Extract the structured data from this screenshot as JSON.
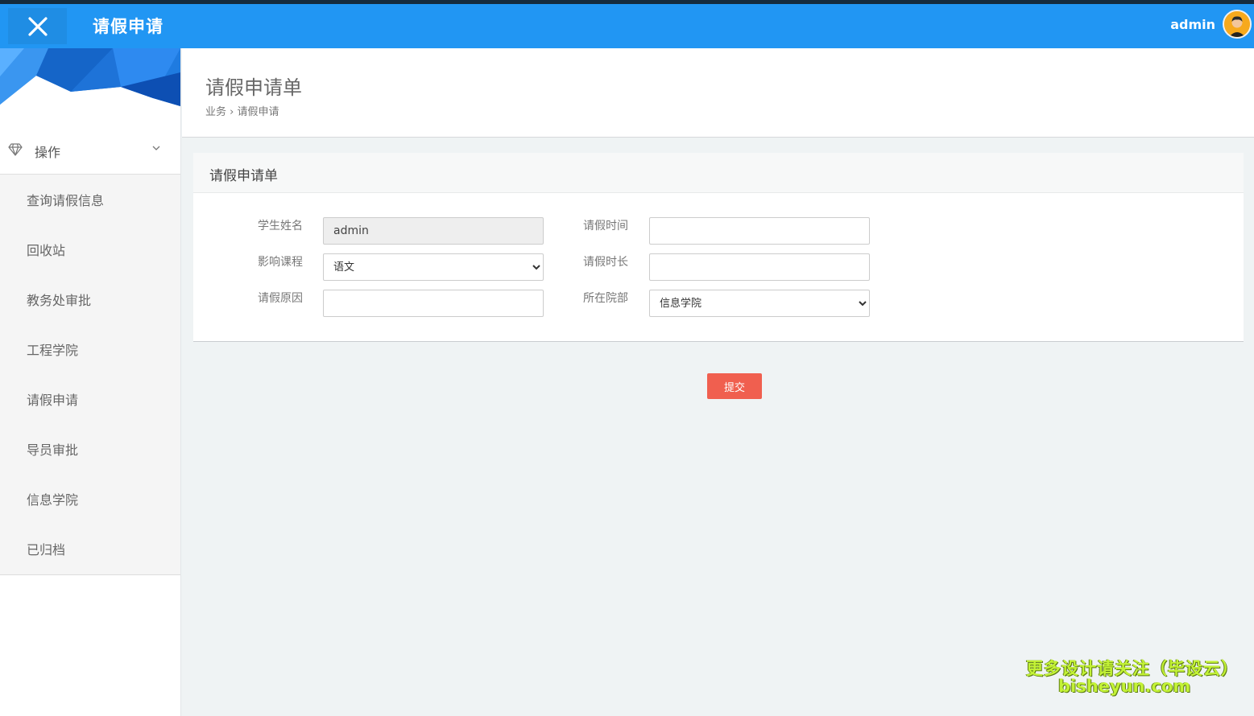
{
  "header": {
    "close_icon": "close-icon",
    "title": "请假申请",
    "user_name": "admin",
    "brand_color": "#2196f3"
  },
  "sidebar": {
    "group": {
      "icon": "diamond-icon",
      "label": "操作",
      "chevron": "chevron-down-icon"
    },
    "items": [
      {
        "label": "查询请假信息"
      },
      {
        "label": "回收站"
      },
      {
        "label": "教务处审批"
      },
      {
        "label": "工程学院"
      },
      {
        "label": "请假申请"
      },
      {
        "label": "导员审批"
      },
      {
        "label": "信息学院"
      },
      {
        "label": "已归档"
      }
    ]
  },
  "page": {
    "title": "请假申请单",
    "breadcrumb": {
      "parent": "业务",
      "separator": "›",
      "current": "请假申请"
    }
  },
  "form": {
    "panel_title": "请假申请单",
    "student_name": {
      "label": "学生姓名",
      "value": "admin"
    },
    "leave_time": {
      "label": "请假时间",
      "value": ""
    },
    "course": {
      "label": "影响课程",
      "selected": "语文"
    },
    "duration": {
      "label": "请假时长",
      "value": ""
    },
    "reason": {
      "label": "请假原因",
      "value": ""
    },
    "department": {
      "label": "所在院部",
      "selected": "信息学院"
    },
    "submit_label": "提交",
    "submit_color": "#f05f4f"
  },
  "watermark": {
    "line1": "更多设计请关注（毕设云）",
    "line2": "bisheyun.com"
  }
}
